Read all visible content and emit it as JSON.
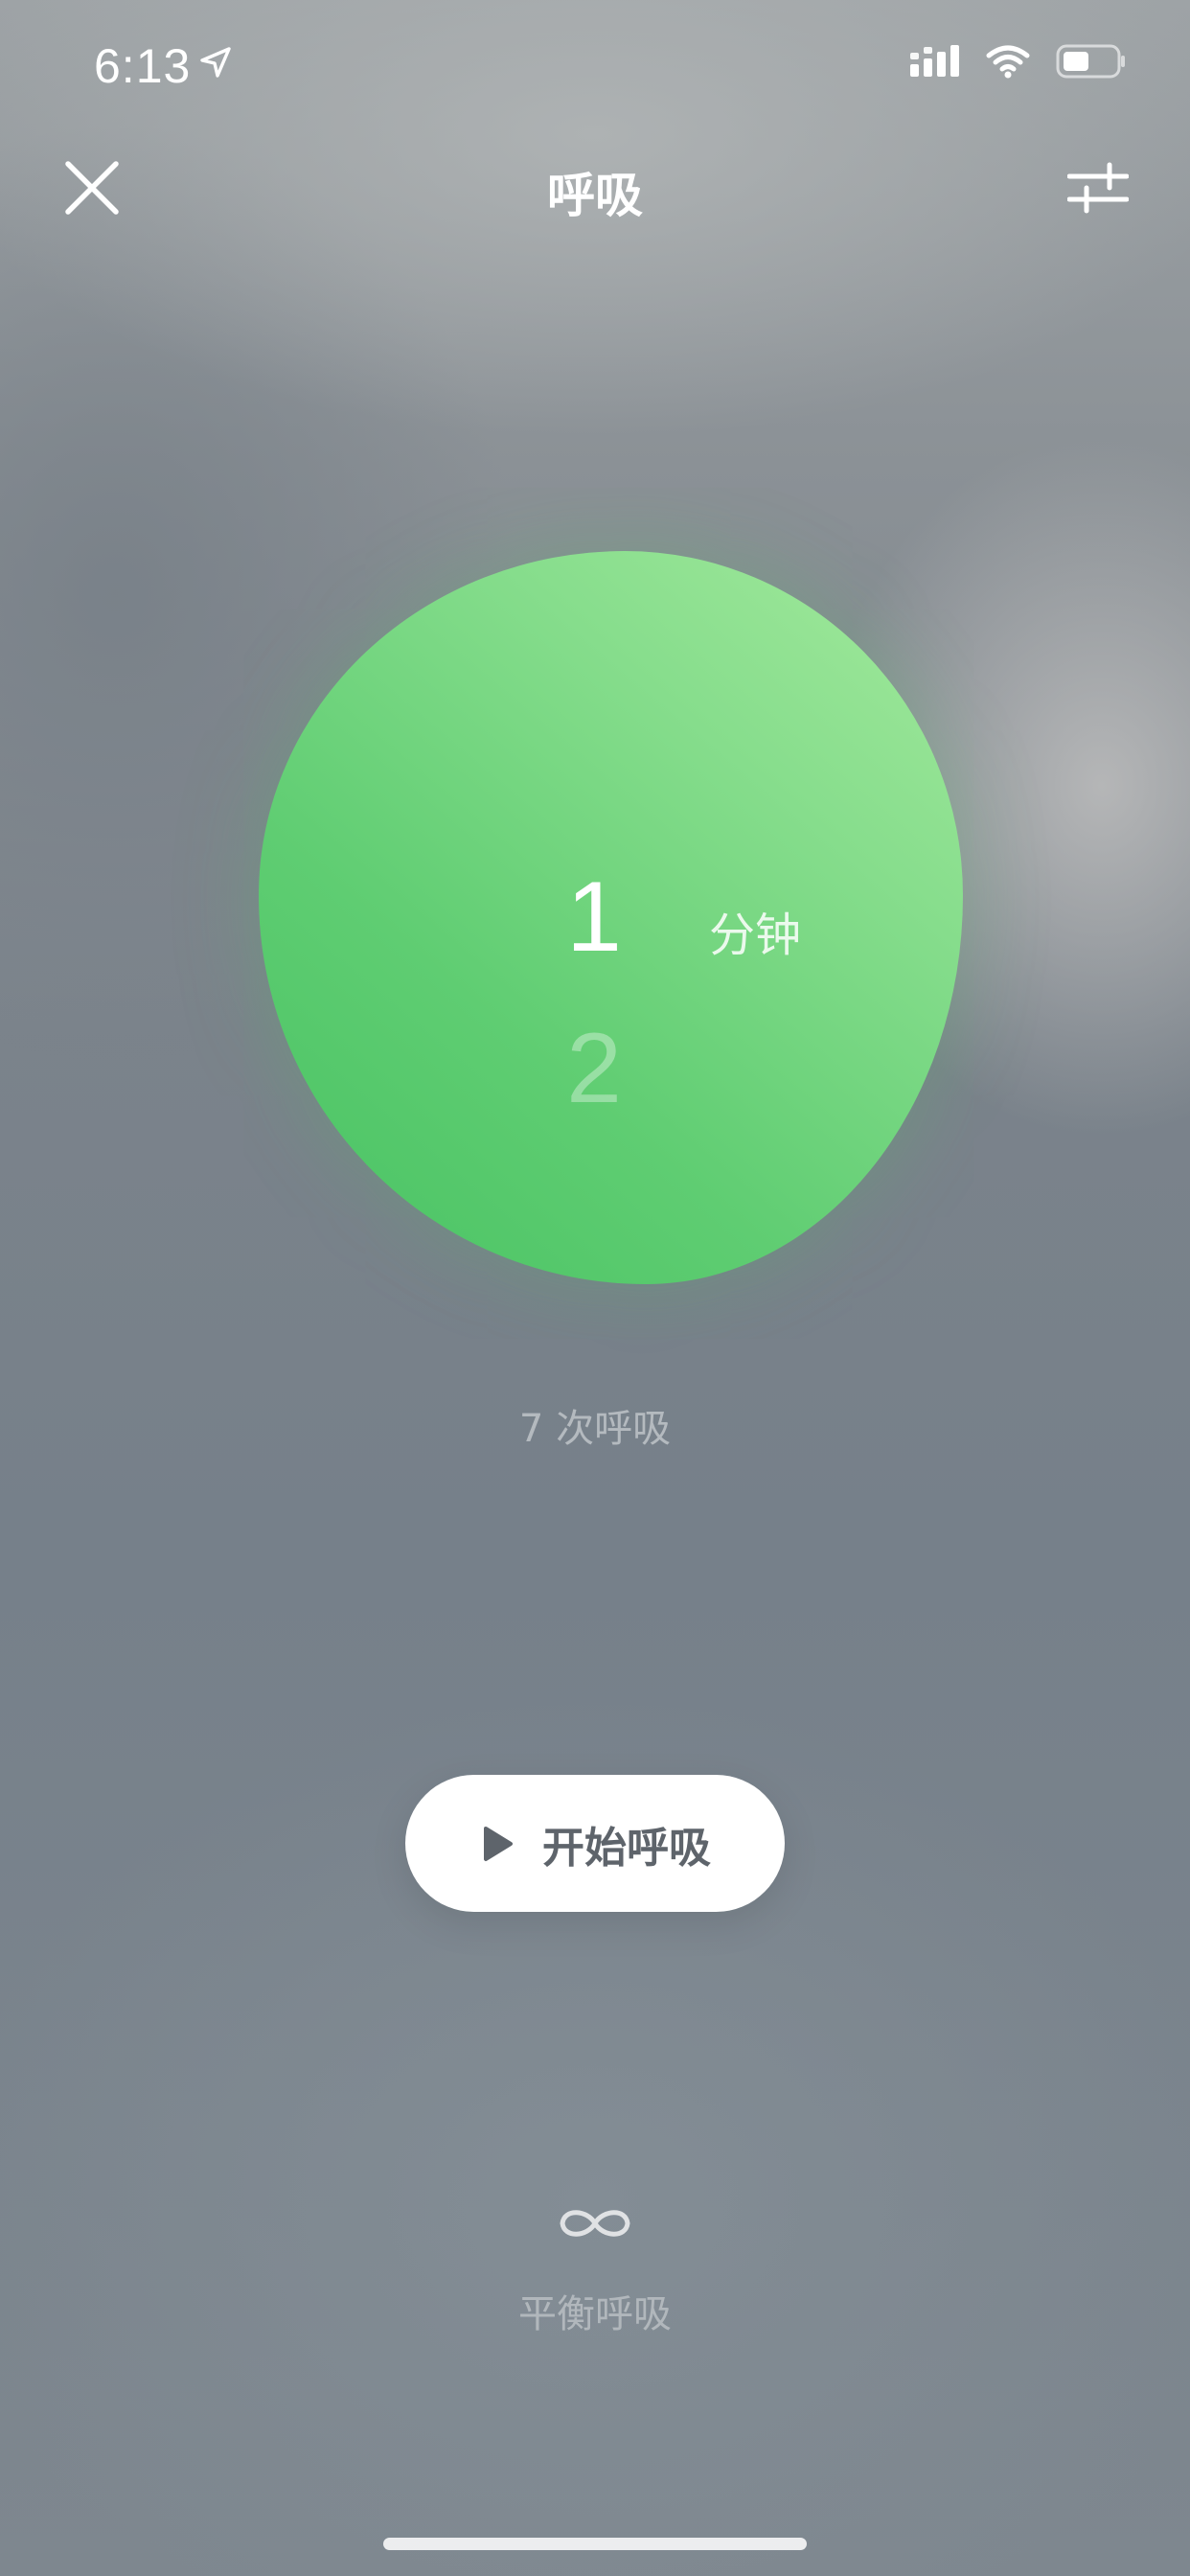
{
  "status_bar": {
    "time": "6:13",
    "icons": [
      "location-arrow-icon",
      "cellular-signal-icon",
      "wifi-icon",
      "battery-icon"
    ]
  },
  "header": {
    "title": "呼吸",
    "close_icon": "close-icon",
    "settings_icon": "sliders-icon"
  },
  "duration_picker": {
    "current_value": "1",
    "next_value": "2",
    "unit": "分钟"
  },
  "breath_count_text": "7 次呼吸",
  "start_button": {
    "icon": "play-icon",
    "label": "开始呼吸"
  },
  "mode": {
    "icon": "infinity-icon",
    "label": "平衡呼吸"
  },
  "colors": {
    "blob_dark": "#47c262",
    "blob_light": "#a4ea9d",
    "button_text": "#5e646b",
    "background": "#7a828a"
  }
}
